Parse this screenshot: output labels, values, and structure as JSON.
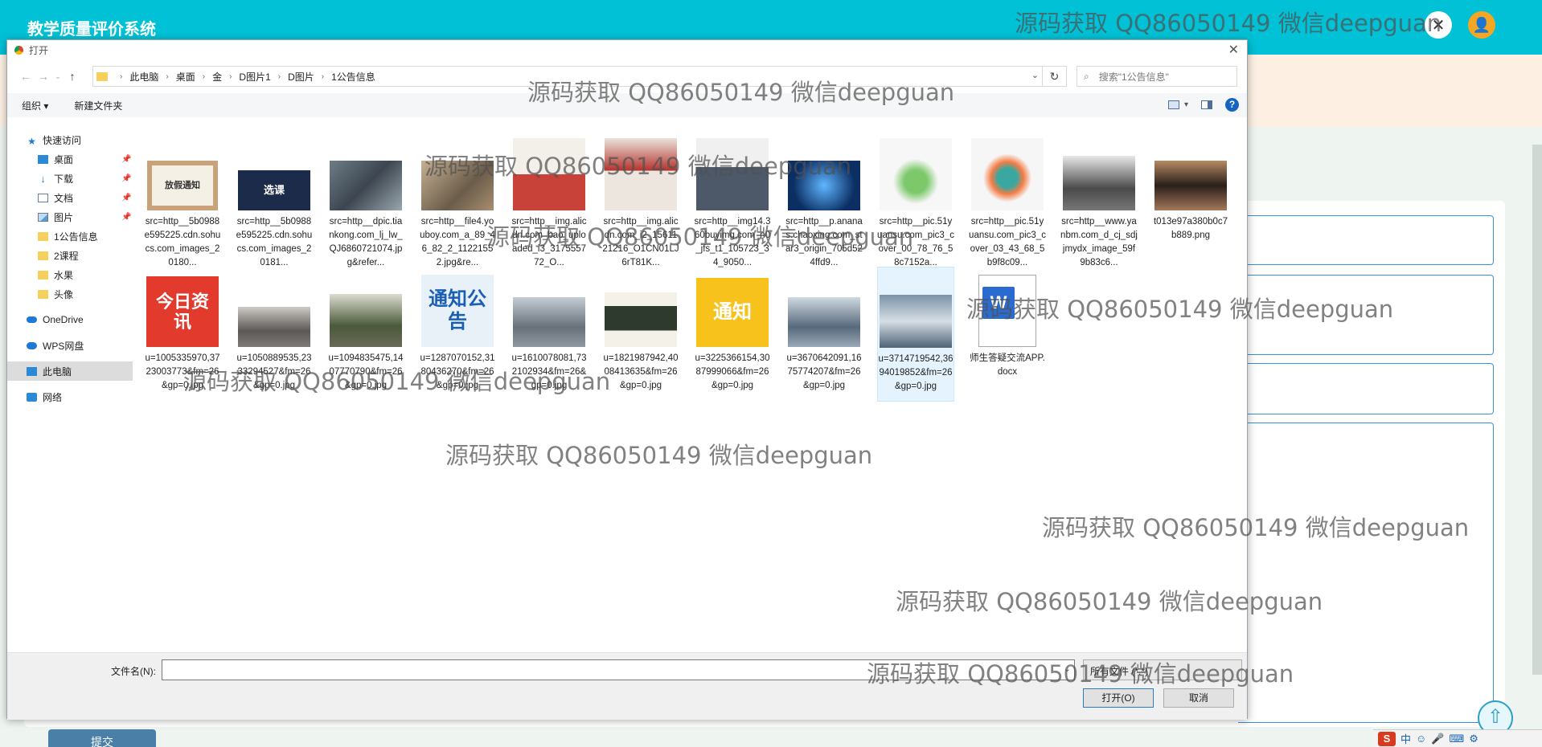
{
  "app": {
    "title": "教学质量评价系统",
    "submit_label": "提交"
  },
  "dialog": {
    "title": "打开",
    "breadcrumb": [
      "此电脑",
      "桌面",
      "金",
      "D图片1",
      "D图片",
      "1公告信息"
    ],
    "search_placeholder": "搜索\"1公告信息\"",
    "toolbar": {
      "organize": "组织 ▾",
      "new_folder": "新建文件夹"
    },
    "nav": {
      "quick_access": "快速访问",
      "items": [
        {
          "label": "桌面",
          "icon": "desktop-icon",
          "pinned": true
        },
        {
          "label": "下载",
          "icon": "download-icon",
          "pinned": true
        },
        {
          "label": "文档",
          "icon": "document-icon",
          "pinned": true
        },
        {
          "label": "图片",
          "icon": "picture-icon",
          "pinned": true
        },
        {
          "label": "1公告信息",
          "icon": "folder-icon",
          "pinned": false
        },
        {
          "label": "2课程",
          "icon": "folder-icon",
          "pinned": false
        },
        {
          "label": "水果",
          "icon": "folder-icon",
          "pinned": false
        },
        {
          "label": "头像",
          "icon": "folder-icon",
          "pinned": false
        }
      ],
      "onedrive": "OneDrive",
      "wps": "WPS网盘",
      "this_pc": "此电脑",
      "network": "网络"
    },
    "files": [
      {
        "name": "src=http__5b0988e595225.cdn.sohucs.com_images_20180..."
      },
      {
        "name": "src=http__5b0988e595225.cdn.sohucs.com_images_20181..."
      },
      {
        "name": "src=http__dpic.tiankong.com_lj_lw_QJ6860721074.jpg&refer..."
      },
      {
        "name": "src=http__file4.youboy.com_a_89_46_82_2_11221552.jpg&re..."
      },
      {
        "name": "src=http__img.alicdn.com_bao_uploaded_i3_317555772_O..."
      },
      {
        "name": "src=http__img.alicdn.com_i2_1561121216_O1CN01LJ6rT81K..."
      },
      {
        "name": "src=http__img14.360buyimg.com_n0_jfs_t1_105723_34_9050..."
      },
      {
        "name": "src=http__p.ananas.chaoxing.com_star3_origin_705d524ffd9..."
      },
      {
        "name": "src=http__pic.51yuansu.com_pic3_cover_00_78_76_58c7152a..."
      },
      {
        "name": "src=http__pic.51yuansu.com_pic3_cover_03_43_68_5b9f8c09..."
      },
      {
        "name": "src=http__www.yanbm.com_d_cj_sdjjmydx_image_59f9b83c6..."
      },
      {
        "name": "t013e97a380b0c7b889.png"
      },
      {
        "name": "u=1005335970,3723003773&fm=26&gp=0.jpg"
      },
      {
        "name": "u=1050889535,2333294527&fm=26&gp=0.jpg"
      },
      {
        "name": "u=1094835475,1407770790&fm=26&gp=0.jpg"
      },
      {
        "name": "u=1287070152,3180436270&fm=26&gp=0.jpg"
      },
      {
        "name": "u=1610078081,732102934&fm=26&gp=0.jpg"
      },
      {
        "name": "u=1821987942,4008413635&fm=26&gp=0.jpg"
      },
      {
        "name": "u=3225366154,3087999066&fm=26&gp=0.jpg"
      },
      {
        "name": "u=3670642091,1675774207&fm=26&gp=0.jpg"
      },
      {
        "name": "u=3714719542,3694019852&fm=26&gp=0.jpg"
      },
      {
        "name": "师生答疑交流APP.docx"
      }
    ],
    "thumb_texts": {
      "xuanke": "选课",
      "jinri": "今日资讯",
      "tongzhi_gonggao": "通知公告",
      "tongzhi": "通知",
      "holiday": "放假通知"
    },
    "filename_label": "文件名(N):",
    "filename_value": "",
    "filetype_label": "所有文件 (*.*)",
    "open_label": "打开(O)",
    "cancel_label": "取消"
  },
  "tray": {
    "ime": "S",
    "lang": "中"
  },
  "watermark": "源码获取 QQ86050149 微信deepguan"
}
